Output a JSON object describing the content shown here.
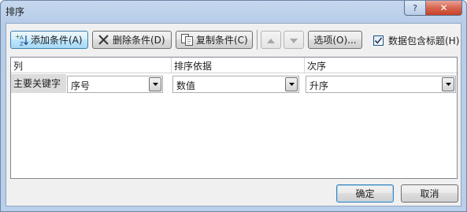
{
  "dialog": {
    "title": "排序",
    "help_label": "?",
    "close_label": "✕"
  },
  "toolbar": {
    "add_label": "添加条件(A)",
    "delete_label": "删除条件(D)",
    "copy_label": "复制条件(C)",
    "options_label": "选项(O)...",
    "header_checkbox_label": "数据包含标题(H)",
    "header_checkbox_checked": true
  },
  "grid": {
    "columns": [
      "列",
      "排序依据",
      "次序"
    ],
    "rows": [
      {
        "label": "主要关键字",
        "column": "序号",
        "sort_on": "数值",
        "order": "升序"
      }
    ]
  },
  "footer": {
    "ok_label": "确定",
    "cancel_label": "取消"
  }
}
